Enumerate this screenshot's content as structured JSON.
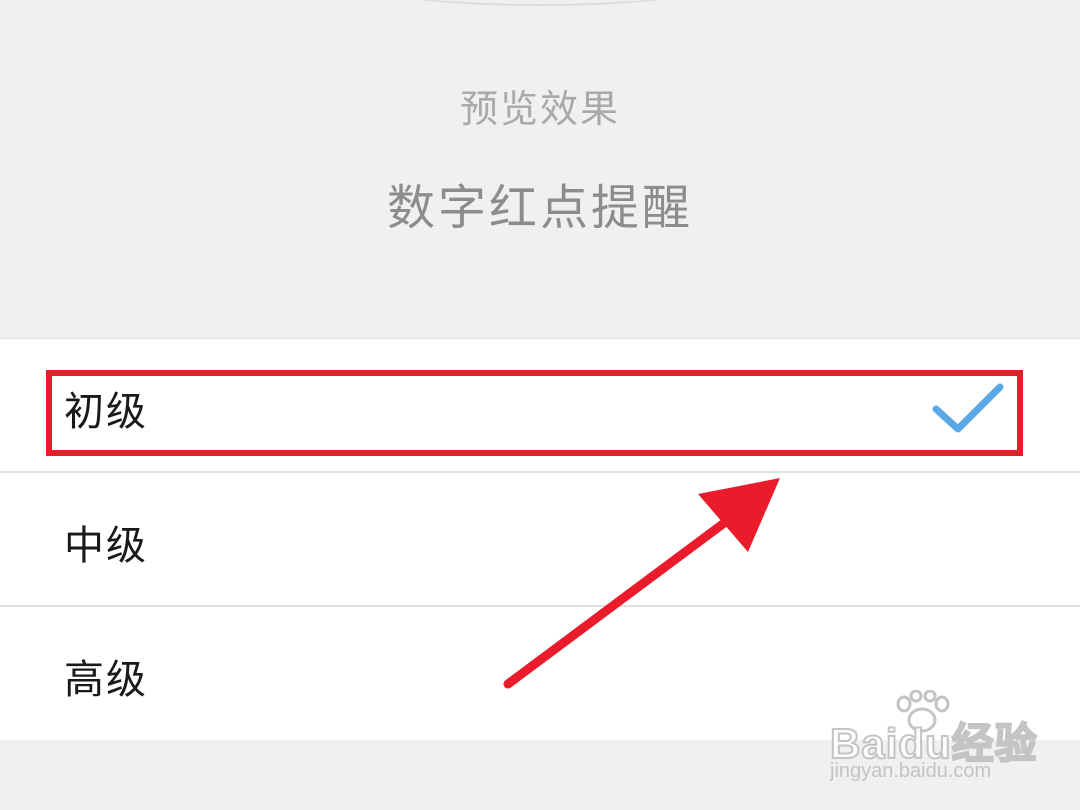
{
  "preview": {
    "label": "预览效果",
    "sample_text": "数字红点提醒"
  },
  "options": [
    {
      "label": "初级",
      "selected": true
    },
    {
      "label": "中级",
      "selected": false
    },
    {
      "label": "高级",
      "selected": false
    }
  ],
  "annotation": {
    "highlight_color": "#ea1c2b",
    "arrow_color": "#ea1c2b"
  },
  "check_color": "#5aa9e6",
  "watermark": {
    "brand": "Baidu经验",
    "url": "jingyan.baidu.com"
  }
}
